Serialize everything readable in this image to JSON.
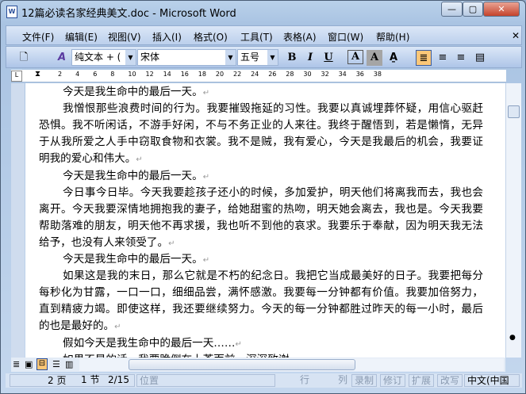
{
  "window": {
    "title": "12篇必读名家经典美文.doc - Microsoft Word",
    "icon": "word-doc-icon"
  },
  "menu": [
    "文件(F)",
    "编辑(E)",
    "视图(V)",
    "插入(I)",
    "格式(O)",
    "工具(T)",
    "表格(A)",
    "窗口(W)",
    "帮助(H)"
  ],
  "toolbar": {
    "style": "纯文本 + (",
    "font": "宋体",
    "size": "五号",
    "bold": "B",
    "italic": "I",
    "underline": "U",
    "border_a": "A",
    "shade_a": "A"
  },
  "ruler": [
    "2",
    "4",
    "6",
    "8",
    "10",
    "12",
    "14",
    "16",
    "18",
    "20",
    "22",
    "24",
    "26",
    "28",
    "30",
    "32",
    "34",
    "36",
    "38"
  ],
  "document": {
    "lines": [
      {
        "t": "今天是我生命中的最后一天。",
        "ind": true,
        "pm": true
      },
      {
        "t": "我憎恨那些浪费时间的行为。我要摧毁拖延的习性。我要以真诚埋葬怀疑，用信心驱赶",
        "ind": true,
        "full": true
      },
      {
        "t": "恐惧。我不听闲话，不游手好闲，不与不务正业的人来往。我终于醒悟到，若是懒惰，无异",
        "full": true
      },
      {
        "t": "于从我所爱之人手中窃取食物和衣裳。我不是贼，我有爱心，今天是我最后的机会，我要证",
        "full": true
      },
      {
        "t": "明我的爱心和伟大。",
        "pm": true
      },
      {
        "t": "今天是我生命中的最后一天。",
        "ind": true,
        "pm": true
      },
      {
        "t": "今日事今日毕。今天我要趁孩子还小的时候，多加爱护，明天他们将离我而去，我也会",
        "ind": true,
        "full": true
      },
      {
        "t": "离开。今天我要深情地拥抱我的妻子，给她甜蜜的热吻，明天她会离去，我也是。今天我要",
        "full": true
      },
      {
        "t": "帮助落难的朋友，明天他不再求援，我也听不到他的哀求。我要乐于奉献，因为明天我无法",
        "full": true
      },
      {
        "t": "给予，也没有人来领受了。",
        "pm": true
      },
      {
        "t": "今天是我生命中的最后一天。",
        "ind": true,
        "pm": true
      },
      {
        "t": "如果这是我的末日，那么它就是不朽的纪念日。我把它当成最美好的日子。我要把每分",
        "ind": true,
        "full": true
      },
      {
        "t": "每秒化为甘露，一口一口，细细品尝，满怀感激。我要每一分钟都有价值。我要加倍努力，",
        "full": true
      },
      {
        "t": "直到精疲力竭。即使这样，我还要继续努力。今天的每一分钟都胜过昨天的每一小时，最后",
        "full": true
      },
      {
        "t": "的也是最好的。",
        "pm": true
      },
      {
        "t": "假如今天是我生命中的最后一天……",
        "ind": true,
        "pm": true
      },
      {
        "t": "如果不是的话，我要跪倒在上苍面前，深深致谢。",
        "ind": true,
        "pm": true
      }
    ],
    "para_mark": "↵"
  },
  "status": {
    "page": "2 页",
    "section": "1 节",
    "pages": "2/15",
    "position": "位置",
    "line": "行",
    "col": "列",
    "rec": "录制",
    "trk": "修订",
    "ext": "扩展",
    "ovr": "改写",
    "lang": "中文(中国"
  }
}
